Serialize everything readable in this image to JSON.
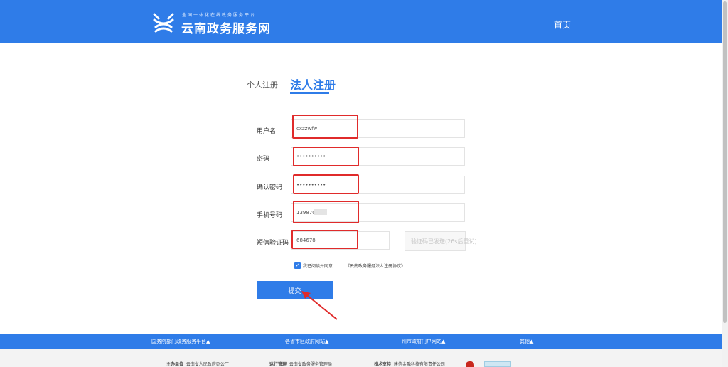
{
  "header": {
    "slogan": "全国一体化在线政务服务平台",
    "site_name": "云南政务服务网",
    "nav_home": "首页"
  },
  "tabs": {
    "personal": "个人注册",
    "legal": "法人注册"
  },
  "form": {
    "username_label": "用户名",
    "username_value": "cxzzwfw",
    "password_label": "密码",
    "password_value": "••••••••••",
    "confirm_label": "确认密码",
    "confirm_value": "••••••••••",
    "phone_label": "手机号码",
    "phone_value": "139870",
    "sms_label": "短信验证码",
    "sms_value": "684678",
    "sms_button": "验证码已发送(26s后重试)"
  },
  "agreement": {
    "check": "✓",
    "text": "我已阅读并同意",
    "link": "《云南政务服务法人注册协议》"
  },
  "submit_label": "提交",
  "footer": {
    "links": [
      "国务院部门政务服务平台▲",
      "各省市区政府网站▲",
      "州市政府门户网站▲",
      "其他▲"
    ],
    "host_label": "主办单位",
    "host_value": "云南省人民政府办公厅",
    "ops_label": "运行管理",
    "ops_value": "云南省政务服务管理局",
    "tech_label": "技术支持",
    "tech_value": "建信金融科技有限责任公司"
  },
  "colors": {
    "primary": "#2f7ce8",
    "highlight": "#e02b2b"
  }
}
